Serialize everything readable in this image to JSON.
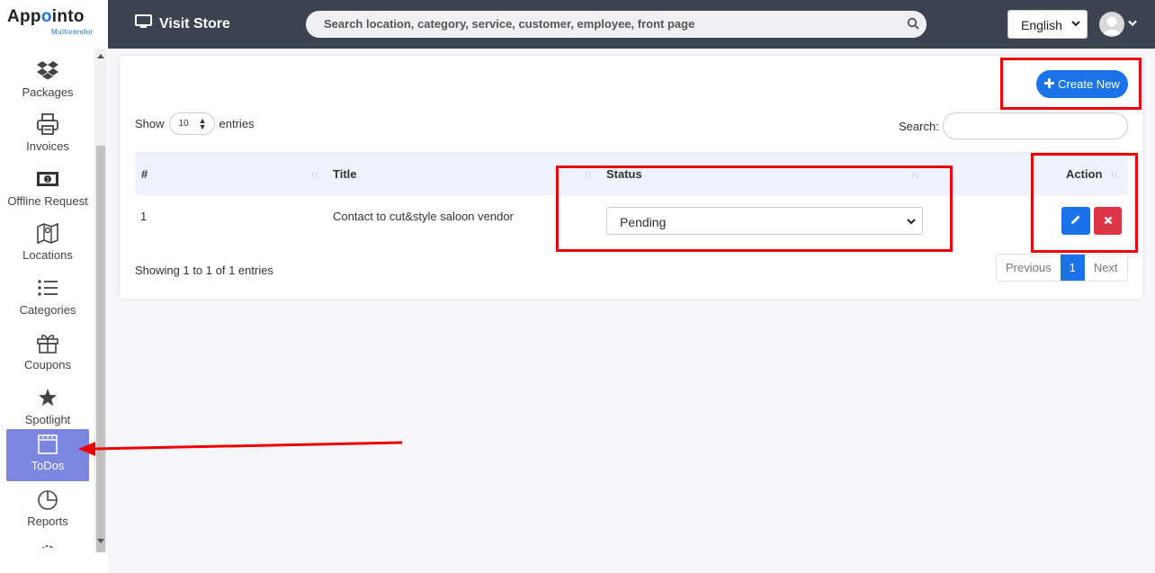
{
  "logo": {
    "main_prefix": "App",
    "main_accent": "o",
    "main_suffix": "into",
    "sub": "Multivendor"
  },
  "sidebar": {
    "items": [
      {
        "label": "Packages",
        "icon": "dropbox-icon"
      },
      {
        "label": "Invoices",
        "icon": "printer-icon"
      },
      {
        "label": "Offline Request",
        "icon": "money-icon"
      },
      {
        "label": "Locations",
        "icon": "map-icon"
      },
      {
        "label": "Categories",
        "icon": "list-icon"
      },
      {
        "label": "Coupons",
        "icon": "gift-icon"
      },
      {
        "label": "Spotlight",
        "icon": "star-icon"
      },
      {
        "label": "ToDos",
        "icon": "notepad-icon",
        "active": true
      },
      {
        "label": "Reports",
        "icon": "pie-chart-icon"
      }
    ]
  },
  "topbar": {
    "visit_store": "Visit Store",
    "search_placeholder": "Search location, category, service, customer, employee, front page",
    "language": "English"
  },
  "content": {
    "create_label": "Create New",
    "show_label": "Show",
    "entries_value": "10",
    "entries_label": "entries",
    "search_label": "Search:",
    "columns": [
      "#",
      "Title",
      "Status",
      "Action"
    ],
    "rows": [
      {
        "num": "1",
        "title": "Contact to cut&style saloon vendor",
        "status": "Pending"
      }
    ],
    "info": "Showing 1 to 1 of 1 entries",
    "pager": {
      "prev": "Previous",
      "current": "1",
      "next": "Next"
    }
  },
  "colors": {
    "primary": "#1a73e8",
    "danger": "#dc3545",
    "sidebar_active": "#7b86e0",
    "topbar": "#3d4451",
    "annotation": "#ee0000"
  }
}
